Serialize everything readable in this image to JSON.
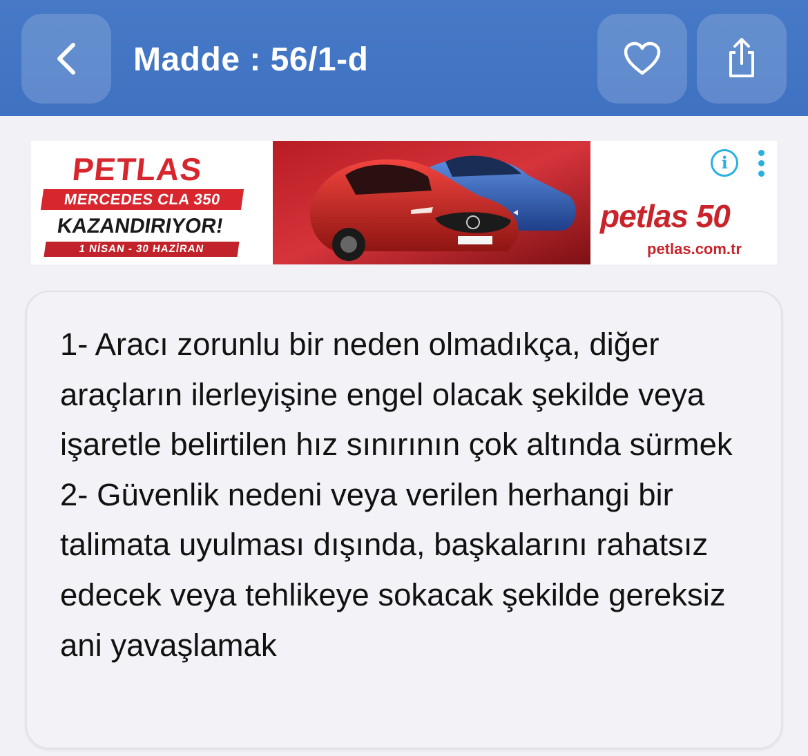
{
  "header": {
    "title": "Madde : 56/1-d",
    "back_icon": "chevron-left-icon",
    "favorite_icon": "heart-icon",
    "share_icon": "share-icon",
    "background_color": "#4679c6"
  },
  "ad": {
    "brand": "PETLAS",
    "line1": "MERCEDES CLA 350",
    "line2": "KAZANDIRIYOR!",
    "line3": "1 NİSAN - 30 HAZİRAN",
    "logo": "petlas 50",
    "url": "petlas.com.tr",
    "info_icon": "info-icon",
    "more_icon": "more-vertical-icon",
    "accent_color": "#d7262d"
  },
  "article": {
    "paragraph1": "1- Aracı zorunlu bir neden olmadıkça, diğer araçların ilerleyişine engel olacak şekilde veya işaretle belirtilen hız sınırının çok altında sürmek",
    "paragraph2": "2- Güvenlik nedeni veya verilen herhangi bir talimata uyulması dışında, başkalarını rahatsız edecek veya tehlikeye sokacak şekilde gereksiz ani yavaşlamak"
  }
}
